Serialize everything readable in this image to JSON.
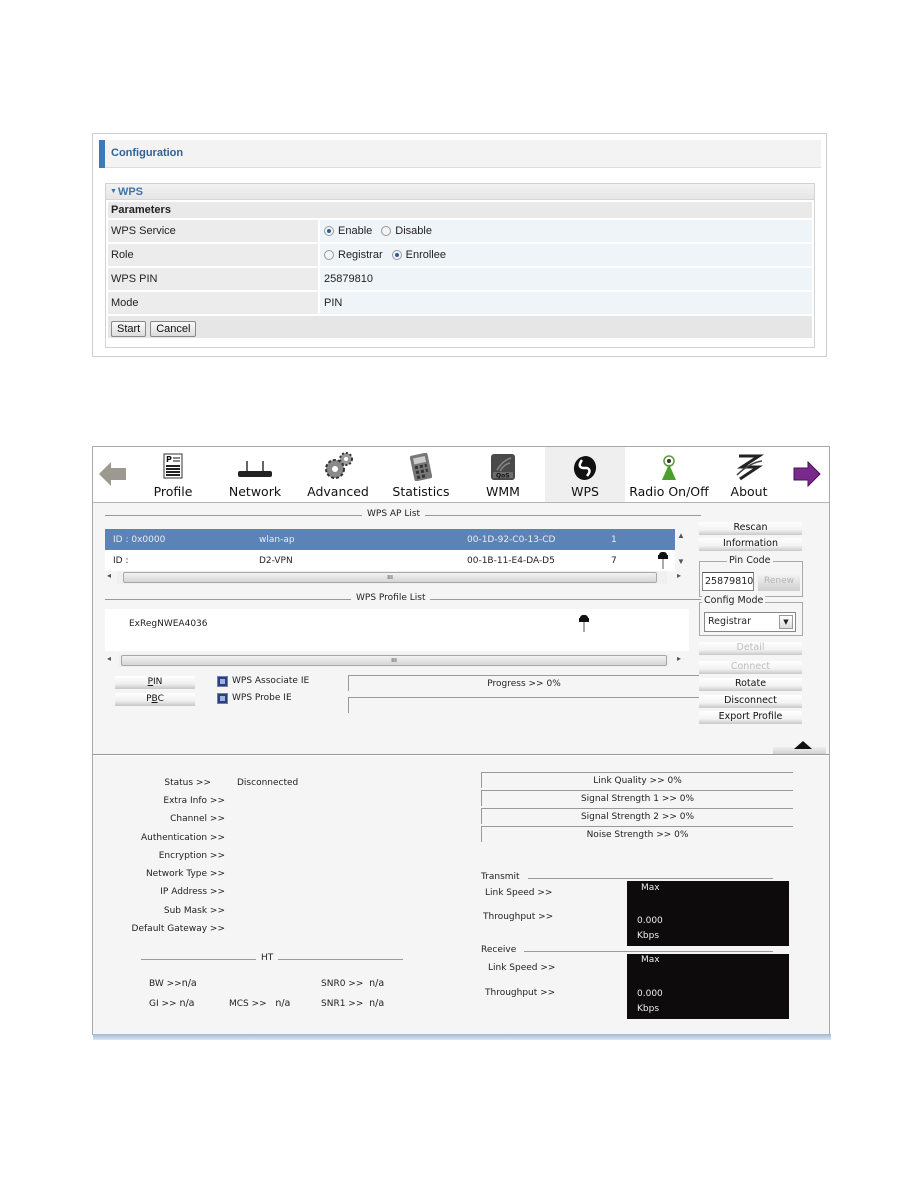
{
  "config_panel": {
    "title": "Configuration",
    "section_title": "WPS",
    "params_header": "Parameters",
    "rows": [
      {
        "label": "WPS Service",
        "options": [
          {
            "label": "Enable",
            "selected": true
          },
          {
            "label": "Disable",
            "selected": false
          }
        ]
      },
      {
        "label": "Role",
        "options": [
          {
            "label": "Registrar",
            "selected": false
          },
          {
            "label": "Enrollee",
            "selected": true
          }
        ]
      },
      {
        "label": "WPS PIN",
        "value": "25879810"
      },
      {
        "label": "Mode",
        "value": "PIN"
      }
    ],
    "buttons": {
      "start": "Start",
      "cancel": "Cancel"
    }
  },
  "utility": {
    "nav": {
      "back_icon": "back-arrow-icon",
      "forward_icon": "forward-arrow-icon",
      "items": [
        {
          "label": "Profile",
          "icon": "profile-icon"
        },
        {
          "label": "Network",
          "icon": "network-icon"
        },
        {
          "label": "Advanced",
          "icon": "advanced-gears-icon"
        },
        {
          "label": "Statistics",
          "icon": "statistics-icon"
        },
        {
          "label": "WMM",
          "icon": "wmm-qos-icon"
        },
        {
          "label": "WPS",
          "icon": "wps-icon",
          "active": true
        },
        {
          "label": "Radio On/Off",
          "icon": "radio-icon"
        },
        {
          "label": "About",
          "icon": "about-icon"
        }
      ]
    },
    "ap_list": {
      "title": "WPS AP List",
      "rows": [
        {
          "id": "ID : 0x0000",
          "ssid": "wlan-ap",
          "bssid": "00-1D-92-C0-13-CD",
          "channel": "1",
          "selected": true
        },
        {
          "id": "ID :",
          "ssid": "D2-VPN",
          "bssid": "00-1B-11-E4-DA-D5",
          "channel": "7",
          "selected": false
        }
      ]
    },
    "profile_list": {
      "title": "WPS Profile List",
      "rows": [
        {
          "name": "ExRegNWEA4036"
        }
      ]
    },
    "side_buttons": {
      "rescan": "Rescan",
      "information": "Information",
      "pin_code_legend": "Pin Code",
      "pin_code_value": "25879810",
      "renew": "Renew",
      "config_mode_legend": "Config Mode",
      "config_mode_value": "Registrar",
      "detail": "Detail",
      "connect": "Connect",
      "rotate": "Rotate",
      "disconnect": "Disconnect",
      "export_profile": "Export Profile"
    },
    "wps_controls": {
      "pin_button": "PIN",
      "pbc_button": "PBC",
      "associate_ie": "WPS Associate IE",
      "probe_ie": "WPS Probe IE",
      "progress_text": "Progress >> 0%",
      "progress_percent": 0
    },
    "status": {
      "labels": {
        "status": "Status >>",
        "extra_info": "Extra Info >>",
        "channel": "Channel >>",
        "authentication": "Authentication >>",
        "encryption": "Encryption >>",
        "network_type": "Network Type >>",
        "ip_address": "IP Address >>",
        "sub_mask": "Sub Mask >>",
        "default_gateway": "Default Gateway >>"
      },
      "values": {
        "status": "Disconnected"
      }
    },
    "signal": {
      "link_quality": "Link Quality >> 0%",
      "signal_strength_1": "Signal Strength 1 >> 0%",
      "signal_strength_2": "Signal Strength 2 >> 0%",
      "noise_strength": "Noise Strength >> 0%"
    },
    "ht": {
      "title": "HT",
      "bw_label": "BW >>",
      "bw_value": "n/a",
      "gi_label": "GI >>",
      "gi_value": "n/a",
      "mcs_label": "MCS >>",
      "mcs_value": "n/a",
      "snr0_label": "SNR0 >>",
      "snr0_value": "n/a",
      "snr1_label": "SNR1 >>",
      "snr1_value": "n/a"
    },
    "transmit": {
      "title": "Transmit",
      "link_speed_label": "Link Speed >>",
      "throughput_label": "Throughput >>",
      "max_label": "Max",
      "value": "0.000",
      "unit": "Kbps"
    },
    "receive": {
      "title": "Receive",
      "link_speed_label": "Link Speed >>",
      "throughput_label": "Throughput >>",
      "max_label": "Max",
      "value": "0.000",
      "unit": "Kbps"
    }
  }
}
